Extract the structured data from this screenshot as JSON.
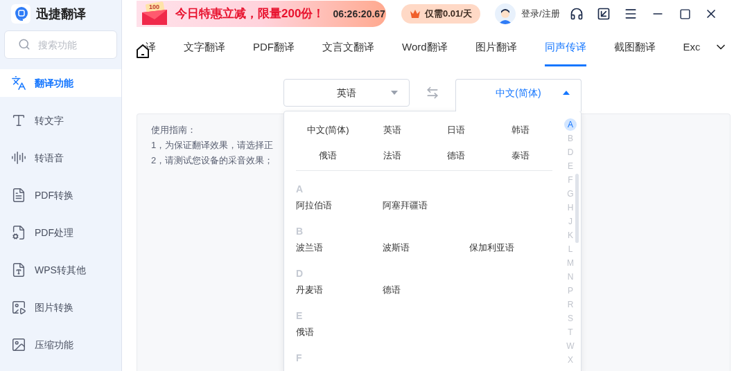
{
  "app": {
    "name": "迅捷翻译"
  },
  "search": {
    "placeholder": "搜索功能"
  },
  "sidebar": {
    "items": [
      {
        "label": "翻译功能",
        "selected": true,
        "kind": "translate"
      },
      {
        "label": "转文字",
        "selected": false,
        "kind": "text"
      },
      {
        "label": "转语音",
        "selected": false,
        "kind": "voice"
      },
      {
        "label": "PDF转换",
        "selected": false,
        "kind": "pdf-convert"
      },
      {
        "label": "PDF处理",
        "selected": false,
        "kind": "pdf-process"
      },
      {
        "label": "WPS转其他",
        "selected": false,
        "kind": "wps"
      },
      {
        "label": "图片转换",
        "selected": false,
        "kind": "image"
      },
      {
        "label": "压缩功能",
        "selected": false,
        "kind": "compress"
      }
    ]
  },
  "promo": {
    "badge": "100",
    "text": "今日特惠立减，限量200份！",
    "timer": "06:26:20.67"
  },
  "vip_offer": "仅需0.01/天",
  "user": {
    "login": "登录/注册"
  },
  "tabs": [
    {
      "label": "译",
      "selected": false
    },
    {
      "label": "文字翻译",
      "selected": false
    },
    {
      "label": "PDF翻译",
      "selected": false
    },
    {
      "label": "文言文翻译",
      "selected": false
    },
    {
      "label": "Word翻译",
      "selected": false
    },
    {
      "label": "图片翻译",
      "selected": false
    },
    {
      "label": "同声传译",
      "selected": true
    },
    {
      "label": "截图翻译",
      "selected": false
    },
    {
      "label": "Exc",
      "selected": false
    }
  ],
  "source_language": {
    "label": "英语",
    "expanded": false
  },
  "target_language": {
    "label": "中文(简体)",
    "expanded": true
  },
  "guide": {
    "title": "使用指南：",
    "lines": [
      "1，为保证翻译效果，请选择正",
      "2，请测试您设备的采音效果；"
    ]
  },
  "dropdown": {
    "popular": [
      "中文(简体)",
      "英语",
      "日语",
      "韩语",
      "俄语",
      "法语",
      "德语",
      "泰语"
    ],
    "sections": [
      {
        "letter": "A",
        "languages": [
          "阿拉伯语",
          "阿塞拜疆语"
        ]
      },
      {
        "letter": "B",
        "languages": [
          "波兰语",
          "波斯语",
          "保加利亚语"
        ]
      },
      {
        "letter": "D",
        "languages": [
          "丹麦语",
          "德语"
        ]
      },
      {
        "letter": "E",
        "languages": [
          "俄语"
        ]
      },
      {
        "letter": "F"
      }
    ],
    "index": [
      {
        "letter": "A",
        "selected": true
      },
      {
        "letter": "B",
        "selected": false
      },
      {
        "letter": "D",
        "selected": false
      },
      {
        "letter": "E",
        "selected": false
      },
      {
        "letter": "F",
        "selected": false
      },
      {
        "letter": "G",
        "selected": false
      },
      {
        "letter": "H",
        "selected": false
      },
      {
        "letter": "J",
        "selected": false
      },
      {
        "letter": "K",
        "selected": false
      },
      {
        "letter": "L",
        "selected": false
      },
      {
        "letter": "M",
        "selected": false
      },
      {
        "letter": "N",
        "selected": false
      },
      {
        "letter": "P",
        "selected": false
      },
      {
        "letter": "R",
        "selected": false
      },
      {
        "letter": "S",
        "selected": false
      },
      {
        "letter": "T",
        "selected": false
      },
      {
        "letter": "W",
        "selected": false
      },
      {
        "letter": "X",
        "selected": false
      }
    ]
  }
}
